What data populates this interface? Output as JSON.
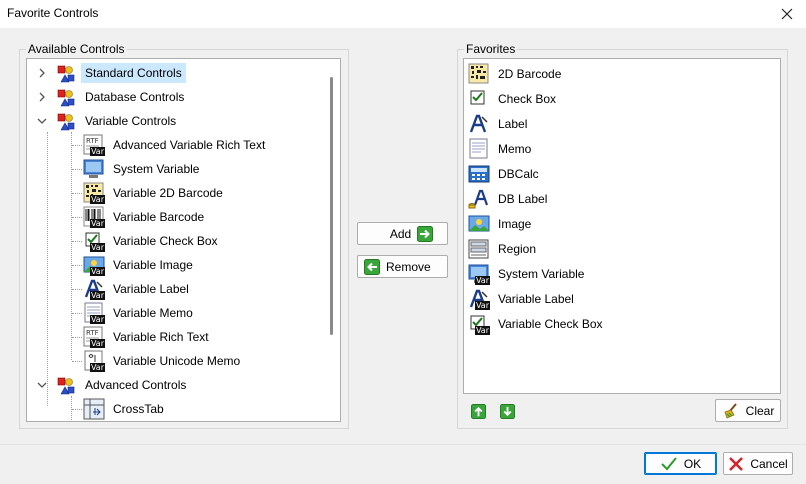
{
  "window": {
    "title": "Favorite Controls"
  },
  "available": {
    "group_label": "Available Controls",
    "items": [
      {
        "label": "Standard Controls",
        "icon": "controls-group-icon",
        "level": 0,
        "expanded": false,
        "selected": true
      },
      {
        "label": "Database Controls",
        "icon": "controls-group-icon",
        "level": 0,
        "expanded": false,
        "selected": false
      },
      {
        "label": "Variable Controls",
        "icon": "controls-group-icon",
        "level": 0,
        "expanded": true,
        "selected": false
      },
      {
        "label": "Advanced Variable Rich Text",
        "icon": "rtf-var-icon",
        "level": 1
      },
      {
        "label": "System Variable",
        "icon": "system-variable-icon",
        "level": 1
      },
      {
        "label": "Variable 2D Barcode",
        "icon": "barcode-2d-var-icon",
        "level": 1
      },
      {
        "label": "Variable Barcode",
        "icon": "barcode-var-icon",
        "level": 1
      },
      {
        "label": "Variable Check Box",
        "icon": "checkbox-var-icon",
        "level": 1
      },
      {
        "label": "Variable Image",
        "icon": "image-var-icon",
        "level": 1
      },
      {
        "label": "Variable Label",
        "icon": "label-var-icon",
        "level": 1
      },
      {
        "label": "Variable Memo",
        "icon": "memo-var-icon",
        "level": 1
      },
      {
        "label": "Variable Rich Text",
        "icon": "rtf-var-icon",
        "level": 1
      },
      {
        "label": "Variable Unicode Memo",
        "icon": "unicode-memo-var-icon",
        "level": 1
      },
      {
        "label": "Advanced Controls",
        "icon": "controls-group-icon",
        "level": 0,
        "expanded": true,
        "selected": false
      },
      {
        "label": "CrossTab",
        "icon": "crosstab-icon",
        "level": 1
      }
    ]
  },
  "actions": {
    "add_label": "Add",
    "remove_label": "Remove"
  },
  "favorites": {
    "group_label": "Favorites",
    "items": [
      {
        "label": "2D Barcode",
        "icon": "barcode-2d-icon"
      },
      {
        "label": "Check Box",
        "icon": "checkbox-icon"
      },
      {
        "label": "Label",
        "icon": "label-icon"
      },
      {
        "label": "Memo",
        "icon": "memo-icon"
      },
      {
        "label": "DBCalc",
        "icon": "dbcalc-icon"
      },
      {
        "label": "DB Label",
        "icon": "db-label-icon"
      },
      {
        "label": "Image",
        "icon": "image-icon"
      },
      {
        "label": "Region",
        "icon": "region-icon"
      },
      {
        "label": "System Variable",
        "icon": "system-variable-var-icon"
      },
      {
        "label": "Variable Label",
        "icon": "label-var-icon"
      },
      {
        "label": "Variable Check Box",
        "icon": "checkbox-var-icon"
      }
    ],
    "clear_label": "Clear"
  },
  "footer": {
    "ok_label": "OK",
    "cancel_label": "Cancel"
  },
  "var_tag": "Var",
  "rtf_tag": "RTF",
  "colors": {
    "accent": "#0078d7",
    "selection": "#cce8ff",
    "add_green": "#2e9b2e",
    "cancel_red": "#d6202a"
  }
}
